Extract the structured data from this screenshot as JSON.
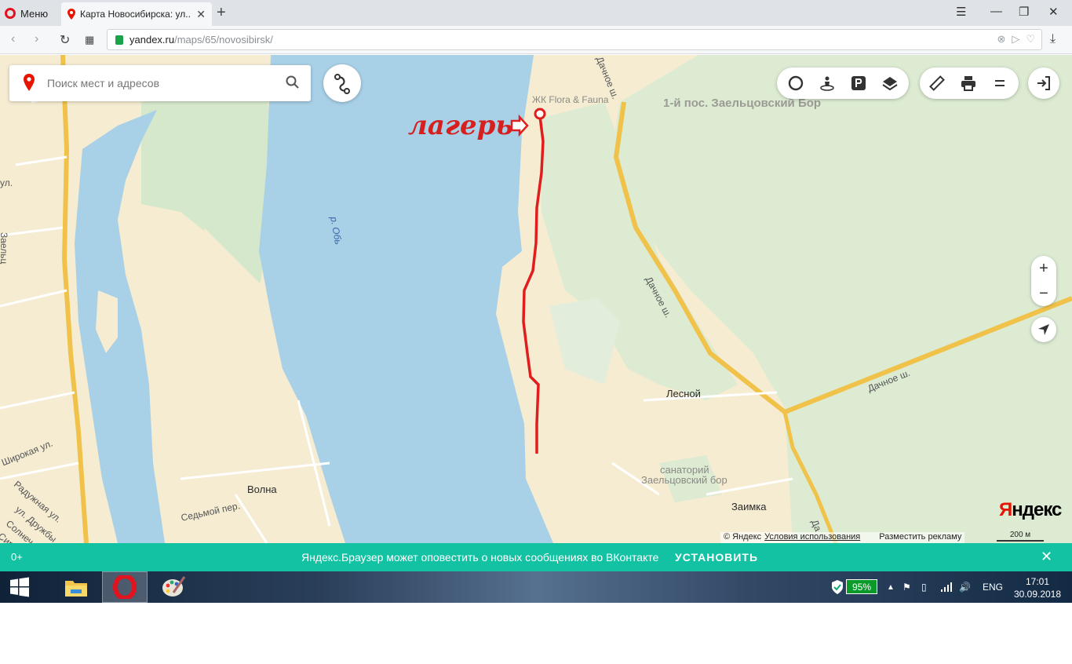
{
  "browser": {
    "menu_label": "Меню",
    "tab_title": "Карта Новосибирска: ул...",
    "url_host": "yandex.ru",
    "url_path": "/maps/65/novosibirsk/"
  },
  "map": {
    "search_placeholder": "Поиск мест и адресов",
    "labels": {
      "zhk": "ЖК Flora & Fauna",
      "pos": "1-й пос. Заельцовский Бор",
      "river": "р. Обь",
      "lesnoy": "Лесной",
      "sanatoriy_1": "санаторий",
      "sanatoriy_2": "Заельцовский бор",
      "zaimka": "Заимка",
      "volna": "Волна",
      "sedmoy": "Седьмой пер.",
      "dachnoe_1": "Дачное ш.",
      "dachnoe_2": "Дачное ш.",
      "dachnoe_3": "Дачное ш.",
      "dachnoe_4": "Да",
      "shirokaya": "Широкая ул.",
      "raduzhnaya": "Радужная ул.",
      "druzhby": "ул. Дружбы",
      "solnech": "Солнеч",
      "sir": "Сир",
      "ul_left": "ул.",
      "zaeltsov_left": "Заельц"
    },
    "annotation": "лагерь",
    "zoom_in": "+",
    "zoom_out": "−",
    "logo_y": "Я",
    "logo_rest": "ндекс",
    "copyright": "© Яндекс",
    "terms": "Условия использования",
    "ads": "Разместить рекламу",
    "scale": "200 м"
  },
  "notification": {
    "age": "0+",
    "message": "Яндекс.Браузер может оповестить о новых сообщениях во ВКонтакте",
    "install": "УСТАНОВИТЬ",
    "close": "✕"
  },
  "taskbar": {
    "battery": "95%",
    "lang": "ENG",
    "time": "17:01",
    "date": "30.09.2018"
  },
  "colors": {
    "water": "#a8d0e6",
    "land": "#f5ecd2",
    "forest": "#dcebd2",
    "road": "#f0c24a",
    "route": "#e01e1e",
    "notif": "#13c2a3"
  }
}
